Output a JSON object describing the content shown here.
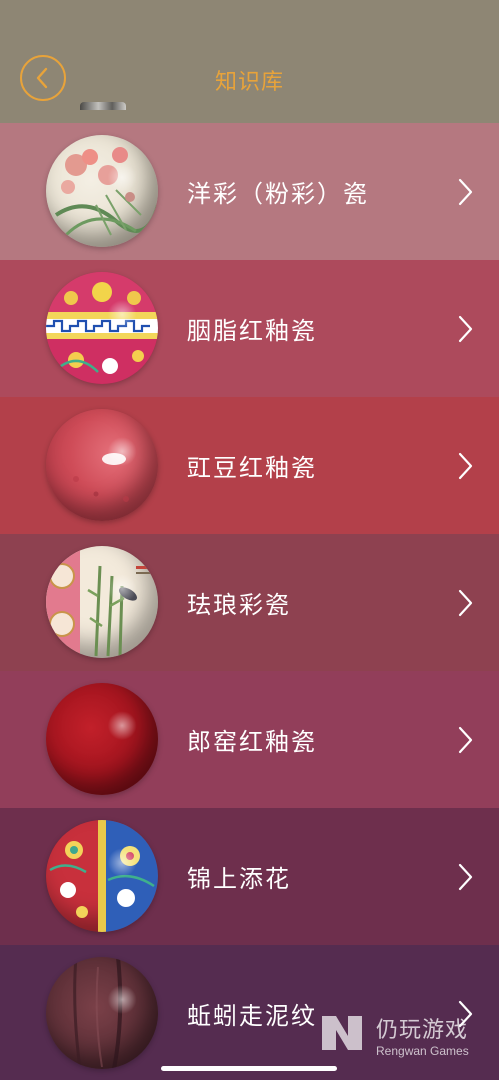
{
  "header": {
    "title": "知识库",
    "back_icon": "chevron-left-icon",
    "accent_color": "#e8a33a",
    "background": "#8e8674"
  },
  "items": [
    {
      "label": "洋彩（粉彩）瓷",
      "bg": "#b57880",
      "icon": "porcelain-ball-famille-rose"
    },
    {
      "label": "胭脂红釉瓷",
      "bg": "#ad4a5c",
      "icon": "porcelain-ball-rouge-enamel"
    },
    {
      "label": "豇豆红釉瓷",
      "bg": "#b3404a",
      "icon": "porcelain-ball-peachbloom"
    },
    {
      "label": "珐琅彩瓷",
      "bg": "#8e4150",
      "icon": "porcelain-ball-enamel-painted"
    },
    {
      "label": "郎窑红釉瓷",
      "bg": "#923e5a",
      "icon": "porcelain-ball-langyao-red"
    },
    {
      "label": "锦上添花",
      "bg": "#6e2f4d",
      "icon": "porcelain-ball-brocade"
    },
    {
      "label": "蚯蚓走泥纹",
      "bg": "#552c50",
      "icon": "porcelain-ball-earthworm-mud"
    }
  ],
  "watermark": {
    "cn": "仍玩游戏",
    "en": "Rengwan Games"
  }
}
